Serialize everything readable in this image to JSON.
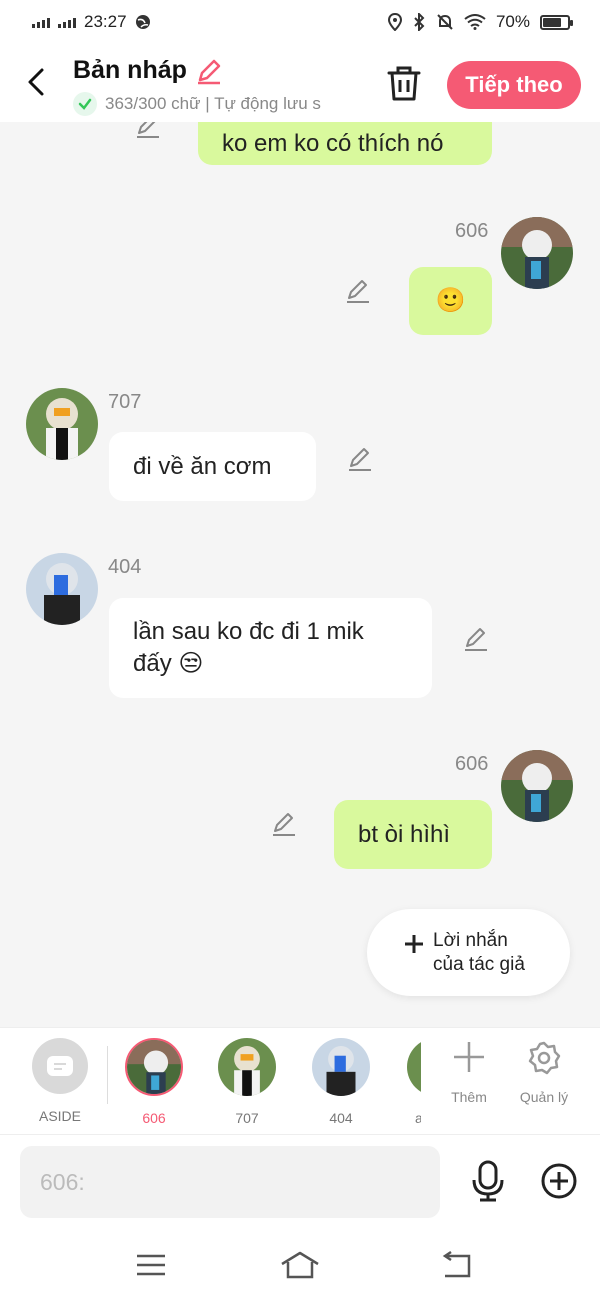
{
  "status_bar": {
    "time": "23:27",
    "battery": "70%"
  },
  "header": {
    "title": "Bản nháp",
    "word_count": "363/300 chữ | Tự động lưu s",
    "next_label": "Tiếp theo"
  },
  "chat": {
    "messages": [
      {
        "text": "ko em ko có thích nó"
      },
      {
        "sender": "606",
        "text": "🙂"
      },
      {
        "sender": "707",
        "text": "đi về ăn cơm"
      },
      {
        "sender": "404",
        "text_line1": "lần sau ko đc đi 1 mik",
        "text_line2": "đấy 😒"
      },
      {
        "sender": "606",
        "text": "bt òi hìhì"
      }
    ],
    "note_line1": "Lời nhắn",
    "note_line2": "của tác giả"
  },
  "charbar": {
    "aside": "ASIDE",
    "chars": [
      "606",
      "707",
      "404",
      "a"
    ],
    "add_label": "Thêm",
    "manage_label": "Quản lý"
  },
  "input": {
    "placeholder": "606:"
  },
  "icons": {
    "accent": "#f55a74",
    "bubble_right": "#d9f99d"
  }
}
